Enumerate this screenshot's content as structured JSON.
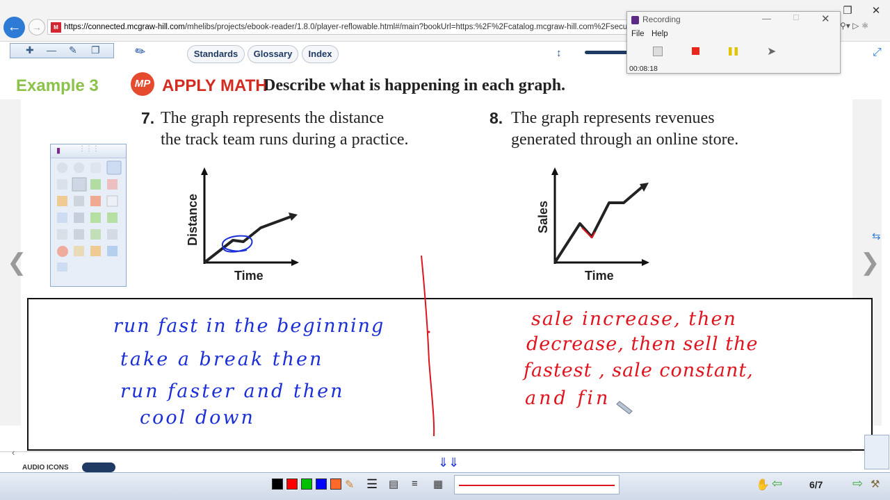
{
  "browser": {
    "url_host": "https://connected.mcgraw-hill.com",
    "url_path": "/mhelibs/projects/ebook-reader/1.8.0/player-reflowable.html#/main?bookUrl=https:%2F%2Fcatalog.mcgraw-hill.com%2Fsecu"
  },
  "toolbar": {
    "standards": "Standards",
    "glossary": "Glossary",
    "index": "Index"
  },
  "recording": {
    "title": "Recording",
    "menu_file": "File",
    "menu_help": "Help",
    "elapsed": "00:08:18"
  },
  "lesson": {
    "example": "Example 3",
    "mp_badge": "MP",
    "apply_math": "APPLY MATH",
    "heading": "Describe what is happening in each graph.",
    "problems": [
      {
        "number": "7.",
        "line1": "The graph represents the distance",
        "line2": "the track team runs during a practice.",
        "y_label": "Distance",
        "x_label": "Time"
      },
      {
        "number": "8.",
        "line1": "The graph represents revenues",
        "line2": "generated through an online store.",
        "y_label": "Sales",
        "x_label": "Time"
      }
    ]
  },
  "ink": {
    "left": [
      "run fast in the beginning",
      "take a break then",
      "run faster and then",
      "cool down"
    ],
    "right": [
      "sale increase, then",
      "decrease, then sell the",
      "fastest , sale constant,",
      "and fin"
    ],
    "colors": {
      "blue": "#1b2fd6",
      "red": "#e0141e"
    }
  },
  "bottom": {
    "audio_label": "AUDIO ICONS",
    "page_indicator": "6/7",
    "swatches": [
      "#000000",
      "#ff0000",
      "#00c000",
      "#0000ff",
      "#ff6a2a"
    ]
  }
}
